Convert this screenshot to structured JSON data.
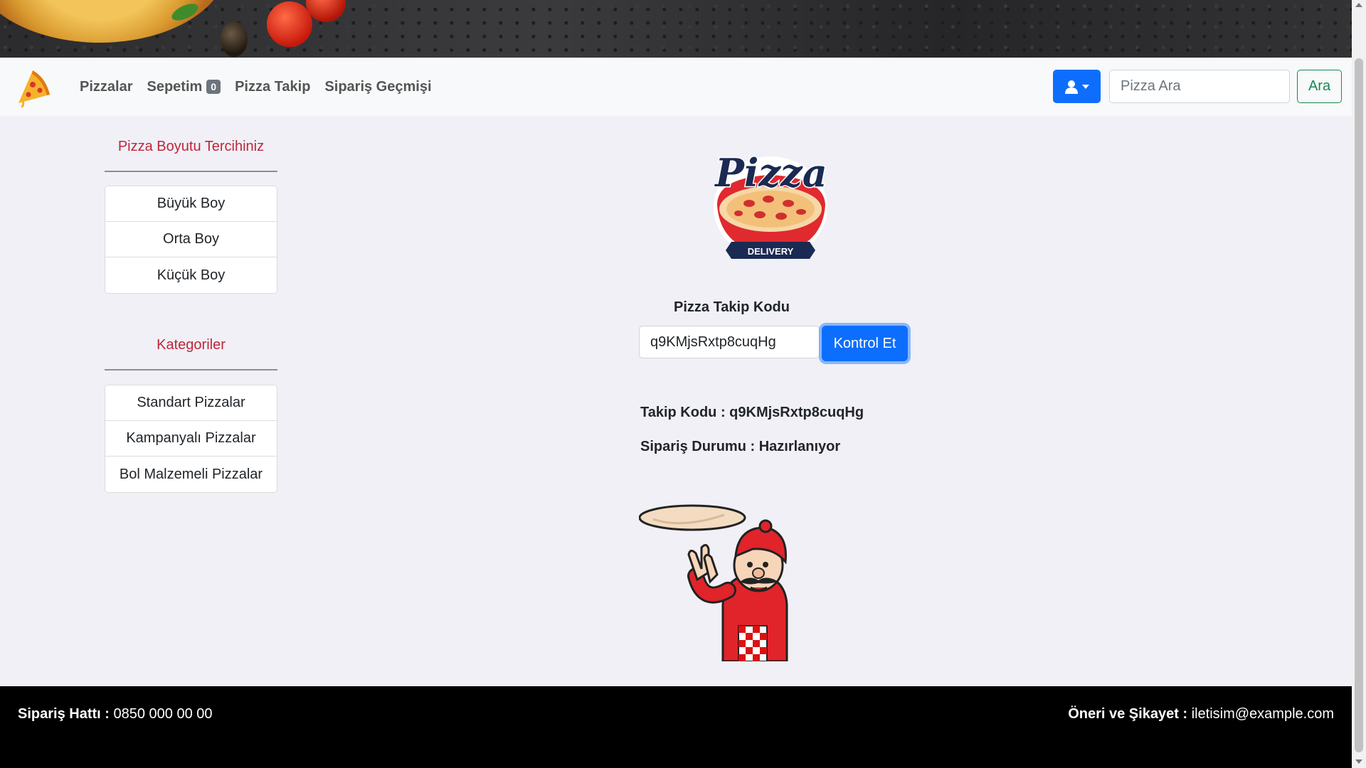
{
  "nav": {
    "pizzas": "Pizzalar",
    "cart": "Sepetim",
    "cart_count": "0",
    "tracking": "Pizza Takip",
    "history": "Sipariş Geçmişi"
  },
  "search": {
    "placeholder": "Pizza Ara",
    "button": "Ara"
  },
  "sidebar": {
    "size_title": "Pizza Boyutu Tercihiniz",
    "sizes": [
      "Büyük Boy",
      "Orta Boy",
      "Küçük Boy"
    ],
    "category_title": "Kategoriler",
    "categories": [
      "Standart Pizzalar",
      "Kampanyalı Pizzalar",
      "Bol Malzemeli Pizzalar"
    ]
  },
  "logo": {
    "line1": "Pizza",
    "line2": "DELIVERY"
  },
  "tracking": {
    "label": "Pizza Takip Kodu",
    "input_value": "q9KMjsRxtp8cuqHg",
    "button": "Kontrol Et",
    "code_line": "Takip Kodu : q9KMjsRxtp8cuqHg",
    "status_line": "Sipariş Durumu : Hazırlanıyor"
  },
  "footer": {
    "phone_label": "Sipariş Hattı :",
    "phone": "0850 000 00 00",
    "contact_label": "Öneri ve Şikayet :",
    "email": "iletisim@example.com"
  },
  "colors": {
    "primary": "#0d6efd",
    "success": "#198754",
    "accent_red": "#c0263a",
    "footer_bg": "#000000"
  },
  "icons": [
    "pizza-slice-logo-icon",
    "user-icon",
    "caret-down-icon"
  ]
}
